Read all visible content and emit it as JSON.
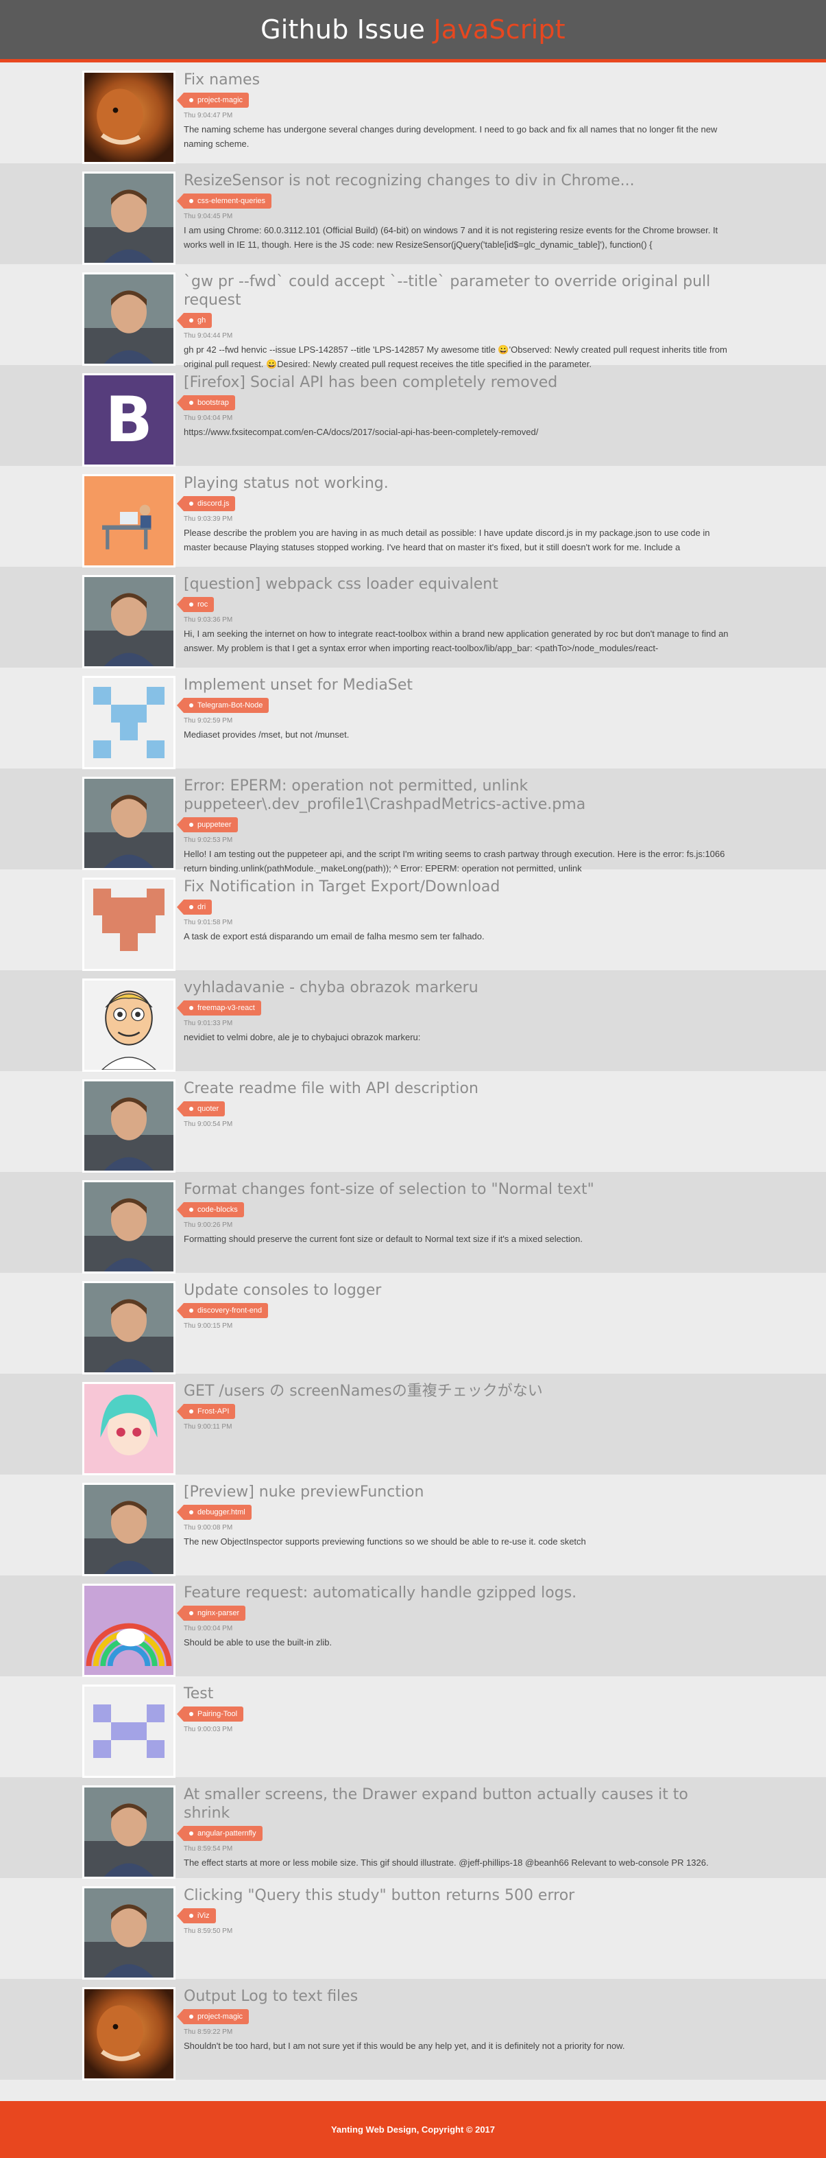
{
  "header": {
    "title_main": "Github Issue",
    "title_accent": "JavaScript"
  },
  "colors": {
    "accent": "#e8471f",
    "tag": "#ee7658",
    "header_bg": "#5b5b5b"
  },
  "issues": [
    {
      "title": "Fix names",
      "tag": "project-magic",
      "time": "Thu 9:04:47 PM",
      "body": "The naming scheme has undergone several changes during development. I need to go back and fix all names that no longer fit the new naming scheme.",
      "avatar": "fox-avatar"
    },
    {
      "title": "ResizeSensor is not recognizing changes to div in Chrome...",
      "tag": "css-element-queries",
      "time": "Thu 9:04:45 PM",
      "body": "I am using Chrome: 60.0.3112.101 (Official Build) (64-bit) on windows 7 and it is not registering resize events for the Chrome browser. It works well in IE 11, though. Here is the JS code: new ResizeSensor(jQuery('table[id$=glc_dynamic_table]'), function() {",
      "avatar": "person-avatar"
    },
    {
      "title": "`gw pr --fwd` could accept `--title` parameter to override original pull request",
      "tag": "gh",
      "time": "Thu 9:04:44 PM",
      "body": "gh pr 42 --fwd henvic --issue LPS-142857 --title 'LPS-142857 My awesome title 😀'Observed: Newly created pull request inherits title from original pull request. 😀Desired: Newly created pull request receives the title specified in the parameter.",
      "avatar": "person-avatar"
    },
    {
      "title": "[Firefox] Social API has been completely removed",
      "tag": "bootstrap",
      "time": "Thu 9:04:04 PM",
      "body": "https://www.fxsitecompat.com/en-CA/docs/2017/social-api-has-been-completely-removed/",
      "avatar": "bootstrap-logo"
    },
    {
      "title": "Playing status not working.",
      "tag": "discord.js",
      "time": "Thu 9:03:39 PM",
      "body": "Please describe the problem you are having in as much detail as possible: I have update discord.js in my package.json to use code in master because Playing statuses stopped working. I've heard that on master it's fixed, but it still doesn't work for me. Include a",
      "avatar": "desk-illustration"
    },
    {
      "title": "[question] webpack css loader equivalent",
      "tag": "roc",
      "time": "Thu 9:03:36 PM",
      "body": "Hi, I am seeking the internet on how to integrate react-toolbox within a brand new application generated by roc but don't manage to find an answer. My problem is that I get a syntax error when importing react-toolbox/lib/app_bar: <pathTo>/node_modules/react-",
      "avatar": "person-avatar"
    },
    {
      "title": "Implement unset for MediaSet",
      "tag": "Telegram-Bot-Node",
      "time": "Thu 9:02:59 PM",
      "body": "Mediaset provides /mset, but not /munset.",
      "avatar": "identicon-blue"
    },
    {
      "title": "Error: EPERM: operation not permitted, unlink puppeteer\\.dev_profile1\\CrashpadMetrics-active.pma",
      "tag": "puppeteer",
      "time": "Thu 9:02:53 PM",
      "body": "Hello! I am testing out the puppeteer api, and the script I'm writing seems to crash partway through execution. Here is the error: fs.js:1066 return binding.unlink(pathModule._makeLong(path)); ^ Error: EPERM: operation not permitted, unlink",
      "avatar": "person-avatar"
    },
    {
      "title": "Fix Notification in Target Export/Download",
      "tag": "dri",
      "time": "Thu 9:01:58 PM",
      "body": "A task de export está disparando um email de falha mesmo sem ter falhado.",
      "avatar": "identicon-orange"
    },
    {
      "title": "vyhladavanie - chyba obrazok markeru",
      "tag": "freemap-v3-react",
      "time": "Thu 9:01:33 PM",
      "body": "nevidiet to velmi dobre, ale je to chybajuci obrazok markeru:",
      "avatar": "cartoon-avatar"
    },
    {
      "title": "Create readme file with API description",
      "tag": "quoter",
      "time": "Thu 9:00:54 PM",
      "body": "",
      "avatar": "person-avatar"
    },
    {
      "title": "Format changes font-size of selection to \"Normal text\"",
      "tag": "code-blocks",
      "time": "Thu 9:00:26 PM",
      "body": "Formatting should preserve the current font size or default to Normal text size if it's a mixed selection.",
      "avatar": "person-avatar"
    },
    {
      "title": "Update consoles to logger",
      "tag": "discovery-front-end",
      "time": "Thu 9:00:15 PM",
      "body": "",
      "avatar": "person-avatar"
    },
    {
      "title": "GET /users の screenNamesの重複チェックがない",
      "tag": "Frost-API",
      "time": "Thu 9:00:11 PM",
      "body": "",
      "avatar": "anime-avatar"
    },
    {
      "title": "[Preview] nuke previewFunction",
      "tag": "debugger.html",
      "time": "Thu 9:00:08 PM",
      "body": "The new ObjectInspector supports previewing functions so we should be able to re-use it. code sketch",
      "avatar": "person-avatar"
    },
    {
      "title": "Feature request: automatically handle gzipped logs.",
      "tag": "nginx-parser",
      "time": "Thu 9:00:04 PM",
      "body": "Should be able to use the built-in zlib.",
      "avatar": "rainbow-avatar"
    },
    {
      "title": "Test",
      "tag": "Pairing-Tool",
      "time": "Thu 9:00:03 PM",
      "body": "",
      "avatar": "identicon-purple"
    },
    {
      "title": "At smaller screens, the Drawer expand button actually causes it to shrink",
      "tag": "angular-patternfly",
      "time": "Thu 8:59:54 PM",
      "body": "The effect starts at more or less mobile size. This gif should illustrate. @jeff-phillips-18 @beanh66 Relevant to web-console PR 1326.",
      "avatar": "person-avatar"
    },
    {
      "title": "Clicking \"Query this study\" button returns 500 error",
      "tag": "iViz",
      "time": "Thu 8:59:50 PM",
      "body": "",
      "avatar": "person-avatar"
    },
    {
      "title": "Output Log to text files",
      "tag": "project-magic",
      "time": "Thu 8:59:22 PM",
      "body": "Shouldn't be too hard, but I am not sure yet if this would be any help yet, and it is definitely not a priority for now.",
      "avatar": "fox-avatar"
    }
  ],
  "footer": {
    "text": "Yanting Web Design, Copyright © 2017"
  }
}
